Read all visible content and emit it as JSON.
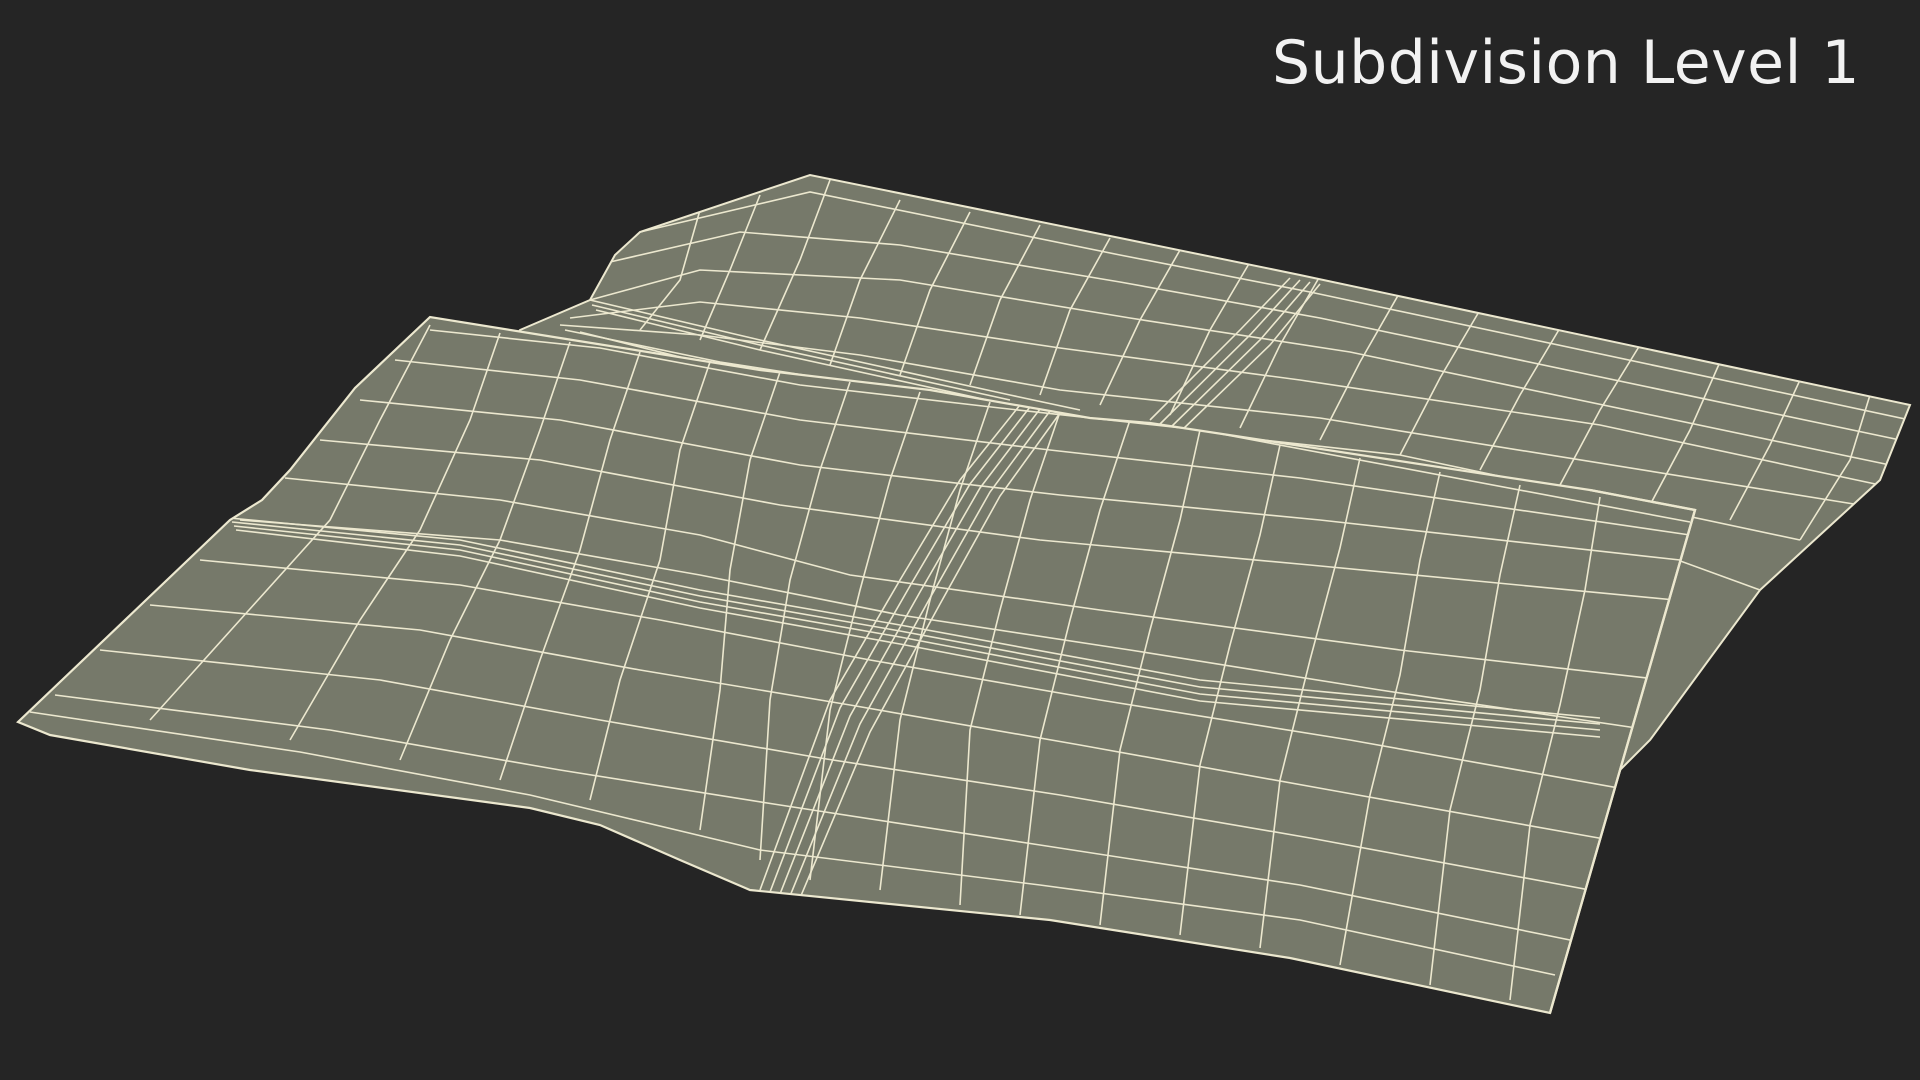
{
  "caption": "Subdivision Level 1",
  "colors": {
    "background": "#252525",
    "surface_fill": "#76796a",
    "wire_color": "#ece8cf",
    "caption_color": "#f2f2f2"
  },
  "scene": {
    "subject": "folded-cloth-wireframe-mesh"
  }
}
